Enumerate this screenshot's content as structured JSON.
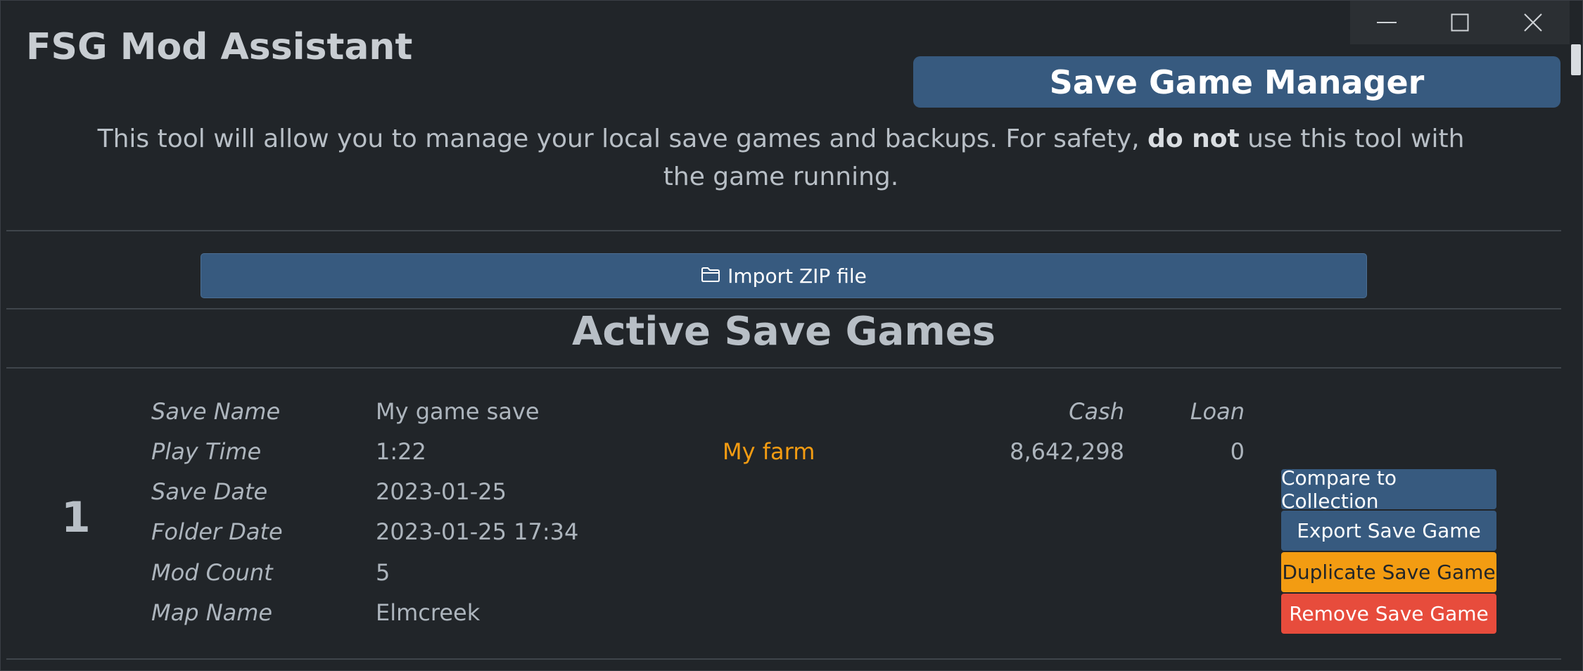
{
  "app": {
    "title": "FSG Mod Assistant"
  },
  "window_controls": {
    "minimize": "minimize-icon",
    "maximize": "maximize-icon",
    "close": "close-icon"
  },
  "header": {
    "manager_label": "Save Game Manager"
  },
  "intro": {
    "text_before": "This tool will allow you to manage your local save games and backups. For safety, ",
    "bold": "do not",
    "text_after": " use this tool with the game running."
  },
  "import": {
    "label": "Import ZIP file",
    "icon": "folder-icon"
  },
  "section": {
    "title": "Active Save Games"
  },
  "save": {
    "index": "1",
    "fields": [
      {
        "label": "Save Name",
        "value": "My game save"
      },
      {
        "label": "Play Time",
        "value": "1:22"
      },
      {
        "label": "Save Date",
        "value": "2023-01-25"
      },
      {
        "label": "Folder Date",
        "value": "2023-01-25 17:34"
      },
      {
        "label": "Mod Count",
        "value": "5"
      },
      {
        "label": "Map Name",
        "value": "Elmcreek"
      }
    ],
    "farm_name": "My farm",
    "cash_label": "Cash",
    "cash_value": "8,642,298",
    "loan_label": "Loan",
    "loan_value": "0",
    "actions": {
      "compare": "Compare to Collection",
      "export": "Export Save Game",
      "duplicate": "Duplicate Save Game",
      "remove": "Remove Save Game"
    }
  },
  "colors": {
    "background": "#212529",
    "primary": "#375a7f",
    "warning": "#f39c12",
    "danger": "#e74c3c",
    "farm_text": "#f39c12"
  }
}
